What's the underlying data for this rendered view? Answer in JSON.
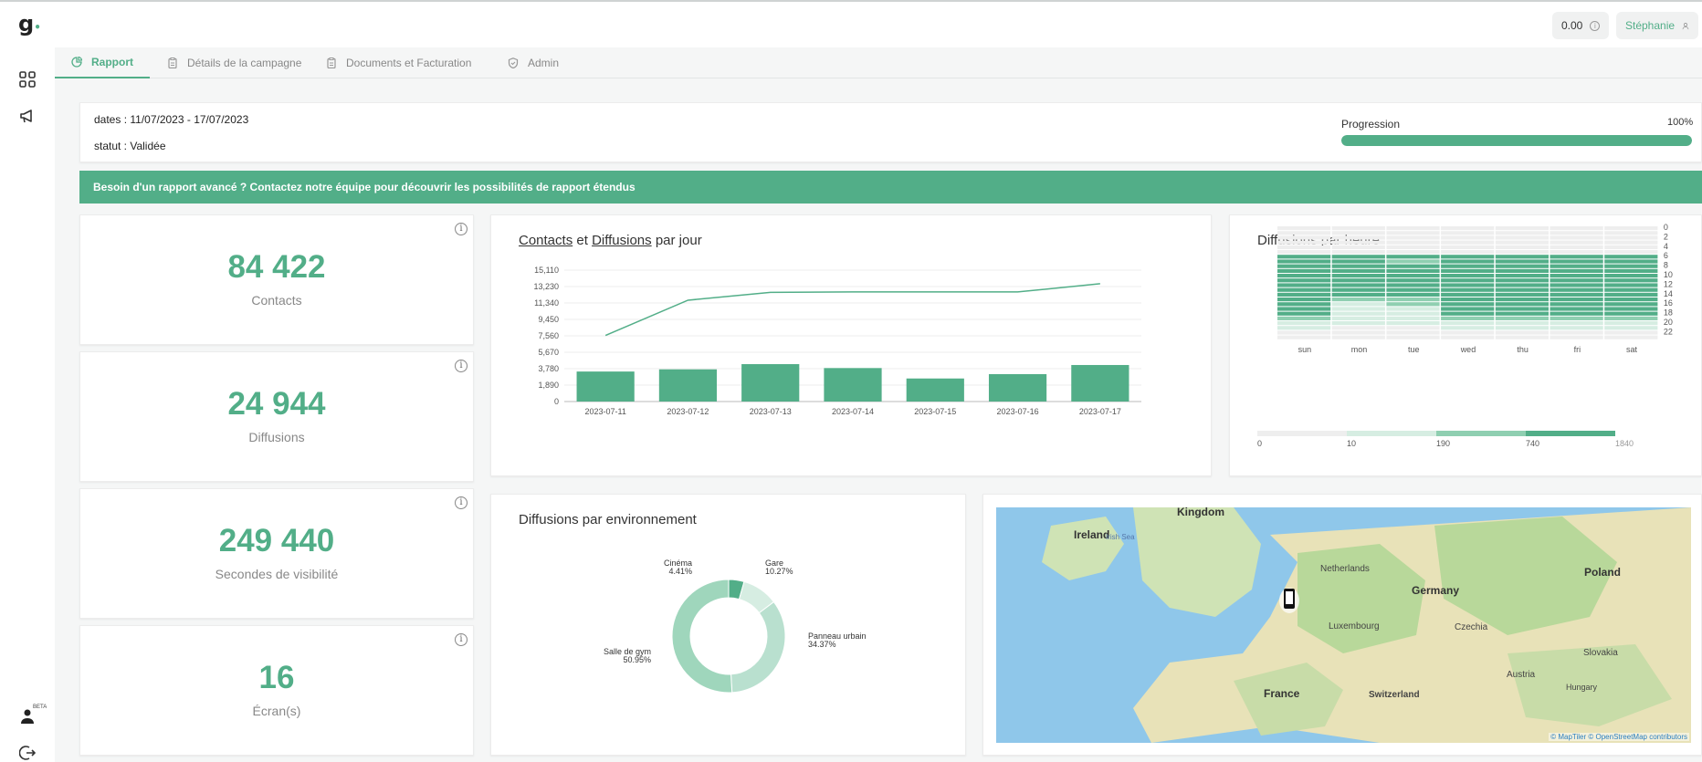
{
  "brand": {
    "logo": "g",
    "logo_dot": "•"
  },
  "header": {
    "credits": "0.00",
    "user_name": "Stéphanie"
  },
  "sidebar": {
    "beta_label": "BETA"
  },
  "tabs": [
    {
      "label": "Rapport",
      "icon": "pie-chart-icon",
      "active": true
    },
    {
      "label": "Détails de la campagne",
      "icon": "clipboard-icon",
      "active": false
    },
    {
      "label": "Documents et Facturation",
      "icon": "clipboard-icon",
      "active": false
    },
    {
      "label": "Admin",
      "icon": "shield-icon",
      "active": false
    }
  ],
  "campaign": {
    "dates": "dates : 11/07/2023 - 17/07/2023",
    "statut": "statut : Validée",
    "progression_label": "Progression",
    "progression_value": "100%",
    "progression_fraction": 1.0
  },
  "banner": "Besoin d'un rapport avancé ? Contactez notre équipe pour découvrir les possibilités de rapport étendus",
  "stats": [
    {
      "value": "84 422",
      "label": "Contacts"
    },
    {
      "value": "24 944",
      "label": "Diffusions"
    },
    {
      "value": "249 440",
      "label": "Secondes de visibilité"
    },
    {
      "value": "16",
      "label": "Écran(s)"
    }
  ],
  "daily_chart_title": {
    "a": "Contacts",
    "mid": " et ",
    "b": "Diffusions",
    "end": " par jour"
  },
  "hourly_title": "Diffusions par heure",
  "env_title": "Diffusions par environnement",
  "colors": {
    "accent": "#52ae88",
    "accent_light": "#b9e0cf",
    "grey_cell": "#eeeeee"
  },
  "chart_data": [
    {
      "type": "bar",
      "title": "Contacts et Diffusions par jour",
      "categories": [
        "2023-07-11",
        "2023-07-12",
        "2023-07-13",
        "2023-07-14",
        "2023-07-15",
        "2023-07-16",
        "2023-07-17"
      ],
      "yticks": [
        "0",
        "1,890",
        "3,780",
        "5,670",
        "7,560",
        "9,450",
        "11,340",
        "13,230",
        "15,110"
      ],
      "ylim": [
        0,
        15110
      ],
      "series": [
        {
          "name": "Diffusions",
          "type": "bar",
          "values": [
            3450,
            3700,
            4300,
            3850,
            2650,
            3150,
            4200
          ]
        },
        {
          "name": "Contacts",
          "type": "line",
          "values": [
            7600,
            11650,
            12550,
            12600,
            12600,
            12600,
            13550
          ]
        }
      ],
      "grid": true
    },
    {
      "type": "heatmap",
      "title": "Diffusions par heure",
      "x": [
        "sun",
        "mon",
        "tue",
        "wed",
        "thu",
        "fri",
        "sat"
      ],
      "y_ticks": [
        "0",
        "2",
        "4",
        "6",
        "8",
        "10",
        "12",
        "14",
        "16",
        "18",
        "20",
        "22"
      ],
      "legend_ticks": [
        "0",
        "10",
        "190",
        "740",
        "1840"
      ],
      "note": "levels per hour (0=none,1=low,2=mid,3=high), rows hour 0-23, cols sun-sat",
      "levels": [
        [
          0,
          0,
          0,
          0,
          0,
          0,
          0
        ],
        [
          0,
          0,
          0,
          0,
          0,
          0,
          0
        ],
        [
          0,
          0,
          0,
          0,
          0,
          0,
          0
        ],
        [
          0,
          0,
          0,
          0,
          0,
          0,
          0
        ],
        [
          0,
          0,
          0,
          0,
          0,
          0,
          0
        ],
        [
          0,
          0,
          0,
          0,
          0,
          0,
          0
        ],
        [
          3,
          3,
          3,
          3,
          3,
          3,
          3
        ],
        [
          3,
          3,
          2,
          3,
          3,
          3,
          3
        ],
        [
          3,
          3,
          3,
          3,
          3,
          3,
          3
        ],
        [
          3,
          3,
          3,
          3,
          3,
          3,
          3
        ],
        [
          3,
          3,
          3,
          3,
          3,
          3,
          3
        ],
        [
          3,
          3,
          3,
          3,
          3,
          3,
          3
        ],
        [
          3,
          3,
          3,
          3,
          3,
          3,
          3
        ],
        [
          3,
          3,
          3,
          3,
          3,
          3,
          3
        ],
        [
          3,
          3,
          3,
          3,
          3,
          3,
          3
        ],
        [
          3,
          2,
          2,
          3,
          3,
          3,
          3
        ],
        [
          3,
          1,
          2,
          3,
          3,
          3,
          3
        ],
        [
          3,
          1,
          1,
          3,
          3,
          3,
          3
        ],
        [
          3,
          1,
          1,
          3,
          3,
          3,
          3
        ],
        [
          2,
          1,
          1,
          2,
          2,
          2,
          2
        ],
        [
          1,
          1,
          1,
          1,
          1,
          1,
          1
        ],
        [
          1,
          0,
          0,
          1,
          1,
          1,
          1
        ],
        [
          0,
          0,
          0,
          0,
          0,
          0,
          0
        ],
        [
          0,
          0,
          0,
          0,
          0,
          0,
          0
        ]
      ]
    },
    {
      "type": "pie",
      "title": "Diffusions par environnement",
      "slices": [
        {
          "name": "Cinéma",
          "value": 4.41,
          "label": "4.41%"
        },
        {
          "name": "Gare",
          "value": 10.27,
          "label": "10.27%"
        },
        {
          "name": "Panneau urbain",
          "value": 34.37,
          "label": "34.37%"
        },
        {
          "name": "Salle de gym",
          "value": 50.95,
          "label": "50.95%"
        }
      ]
    }
  ],
  "map": {
    "labels": [
      {
        "text": "Kingdom"
      },
      {
        "text": "Ireland"
      },
      {
        "text": "Irish Sea"
      },
      {
        "text": "Netherlands"
      },
      {
        "text": "Germany"
      },
      {
        "text": "Poland"
      },
      {
        "text": "Luxembourg"
      },
      {
        "text": "Czechia"
      },
      {
        "text": "Slovakia"
      },
      {
        "text": "Austria"
      },
      {
        "text": "Hungary"
      },
      {
        "text": "France"
      },
      {
        "text": "Switzerland"
      }
    ],
    "credit": "© MapTiler © OpenStreetMap contributors"
  }
}
